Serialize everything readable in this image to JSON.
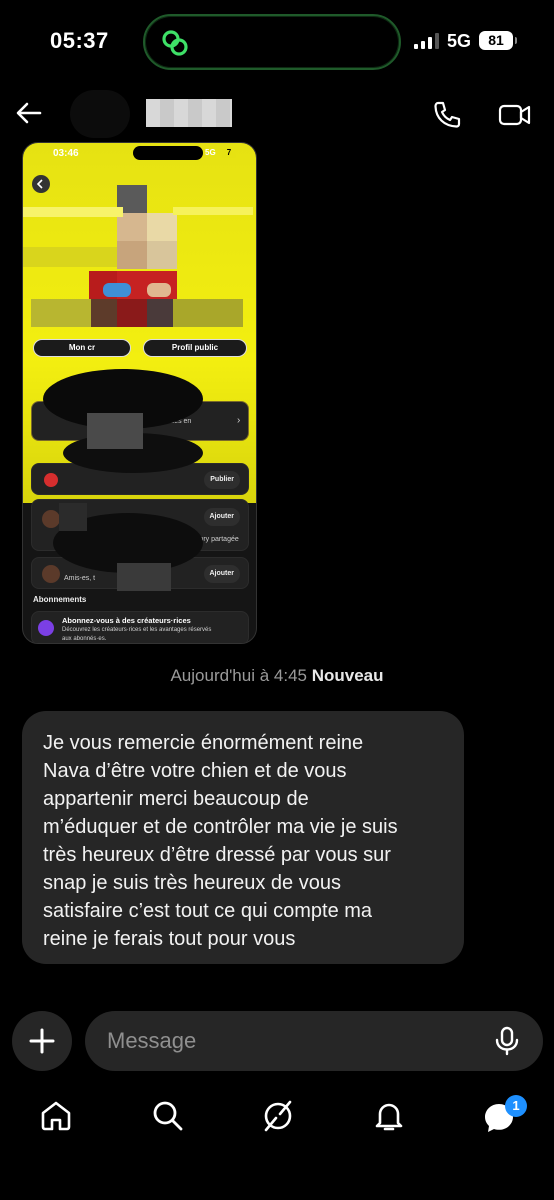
{
  "status_bar": {
    "time": "05:37",
    "network": "5G",
    "battery": "81"
  },
  "header": {
    "contact_name": ""
  },
  "image_message": {
    "status_time": "03:46",
    "status_network": "5G",
    "status_battery": "7",
    "btn_left": "Mon cr",
    "btn_right": "Profil public",
    "card1_text": "…entales en",
    "publish_label": "Publier",
    "add_label_1": "Ajouter",
    "story_text": "elle Story partagée",
    "add_label_2": "Ajouter",
    "friends_text": "Amis-es, t",
    "subscriptions_header": "Abonnements",
    "sub_title": "Abonnez-vous à des créateurs·rices",
    "sub_desc_1": "Découvrez les créateurs·rices et les avantages réservés",
    "sub_desc_2": "aux abonnés·es."
  },
  "timestamp": {
    "date": "Aujourd'hui à 4:45",
    "new_label": "Nouveau"
  },
  "message": {
    "lines": [
      "Je vous remercie énormément reine",
      "Nava d’être votre chien et de vous",
      "appartenir merci beaucoup de",
      "m’éduquer et de contrôler ma vie je suis",
      "très heureux d’être dressé par vous sur",
      "snap je suis très heureux de vous",
      "satisfaire c’est tout ce qui compte ma",
      "reine je ferais tout pour vous"
    ]
  },
  "composer": {
    "placeholder": "Message"
  },
  "nav": {
    "messages_badge": "1"
  },
  "colors": {
    "background": "#000000",
    "bubble": "#262626",
    "accent_badge": "#1e90ff",
    "island_ring": "#1f5a2a"
  }
}
